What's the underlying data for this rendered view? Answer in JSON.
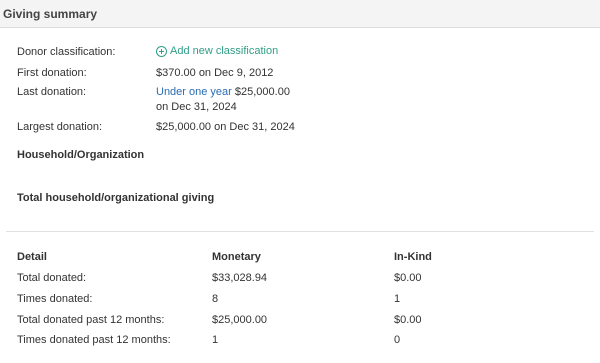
{
  "header": {
    "title": "Giving summary"
  },
  "summary": {
    "donor_classification_label": "Donor classification:",
    "add_classification_label": "Add new classification",
    "first_donation_label": "First donation:",
    "first_donation_value": "$370.00 on Dec 9, 2012",
    "last_donation_label": "Last donation:",
    "last_donation_period": "Under one year",
    "last_donation_amount": "$25,000.00",
    "last_donation_date": "on Dec 31, 2024",
    "largest_donation_label": "Largest donation:",
    "largest_donation_value": "$25,000.00 on Dec 31, 2024"
  },
  "sections": {
    "household": "Household/Organization",
    "total_household": "Total household/organizational giving"
  },
  "table": {
    "headers": [
      "Detail",
      "Monetary",
      "In-Kind"
    ],
    "rows": [
      [
        "Total donated:",
        "$33,028.94",
        "$0.00"
      ],
      [
        "Times donated:",
        "8",
        "1"
      ],
      [
        "Total donated past 12 months:",
        "$25,000.00",
        "$0.00"
      ],
      [
        "Times donated past 12 months:",
        "1",
        "0"
      ]
    ]
  }
}
